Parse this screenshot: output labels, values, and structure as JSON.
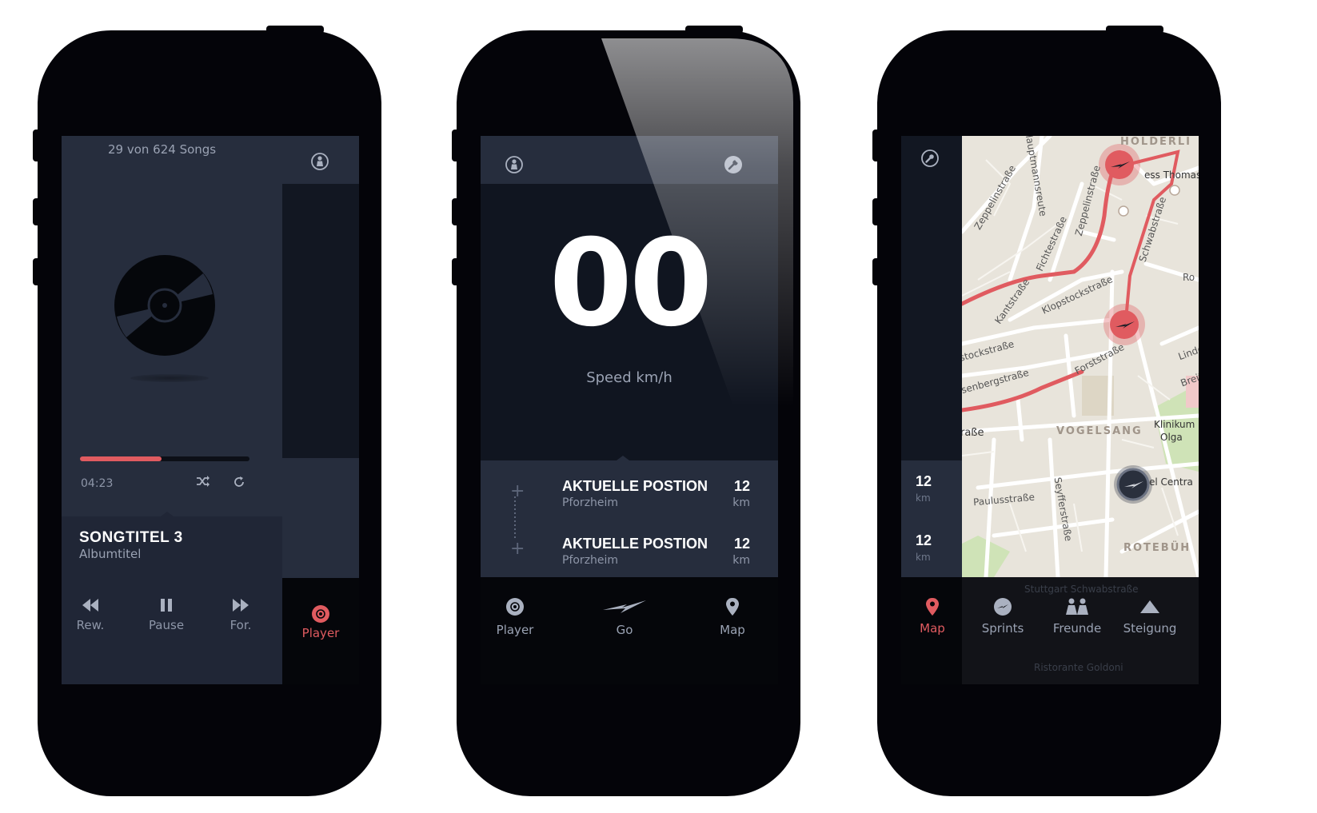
{
  "accent_color": "#e05b60",
  "player_screen": {
    "song_count": "29 von 624 Songs",
    "progress_fraction": 0.48,
    "elapsed_time": "04:23",
    "song_title": "SONGTITEL 3",
    "album_title": "Albumtitel",
    "controls": {
      "rewind": "Rew.",
      "pause": "Pause",
      "forward": "For."
    },
    "active_tab": "Player",
    "icons": [
      "profile-icon",
      "vinyl-record-icon",
      "shuffle-icon",
      "repeat-icon",
      "rewind-icon",
      "pause-icon",
      "fast-forward-icon",
      "record-icon"
    ]
  },
  "speed_screen": {
    "speed_value": "00",
    "speed_label": "Speed km/h",
    "positions": [
      {
        "title": "AKTUELLE POSTION",
        "subtitle": "Pforzheim",
        "distance": "12",
        "unit": "km"
      },
      {
        "title": "AKTUELLE POSTION",
        "subtitle": "Pforzheim",
        "distance": "12",
        "unit": "km"
      }
    ],
    "tabs": {
      "player": "Player",
      "go": "Go",
      "map": "Map"
    },
    "icons": [
      "profile-icon",
      "wrench-icon",
      "plus-icon",
      "record-icon",
      "lightning-icon",
      "location-pin-icon"
    ]
  },
  "map_screen": {
    "stats": [
      {
        "value": "12",
        "unit": "km"
      },
      {
        "value": "12",
        "unit": "km"
      }
    ],
    "tabs": {
      "map": "Map",
      "sprints": "Sprints",
      "freunde": "Freunde",
      "steigung": "Steigung"
    },
    "active_tab": "Map",
    "map_labels": {
      "district_top": "HÖLDERLI",
      "district_mid": "VOGELSANG",
      "district_bottom": "ROTEBÜH",
      "poi_top": "ess Thomas",
      "zeppelin": "Zeppelinstraße",
      "zeppelin_left": "Zeppelinstraße",
      "haupt": "Hauptmannsreute",
      "fichte": "Fichtestraße",
      "schwab": "Schwabstraße",
      "kant": "Kantstraße",
      "klopstock": "Klopstockstraße",
      "forst": "Forststraße",
      "stock": "stockstraße",
      "rosenberg": "senbergstraße",
      "strasse": "raße",
      "klinikum": "Klinikum",
      "olga": "Olga",
      "centra": "el Centra",
      "paulus": "Paulusstraße",
      "seyffer": "Seyfferstraße",
      "linden": "Linde",
      "breit": "Breit",
      "ro": "Ro",
      "stop": "Stuttgart Schwabstraße",
      "restaurant": "Ristorante Goldoni"
    },
    "icons": [
      "wrench-icon",
      "location-pin-icon",
      "lightning-icon",
      "friends-icon",
      "mountain-icon",
      "sprint-marker-icon",
      "current-position-icon"
    ]
  }
}
